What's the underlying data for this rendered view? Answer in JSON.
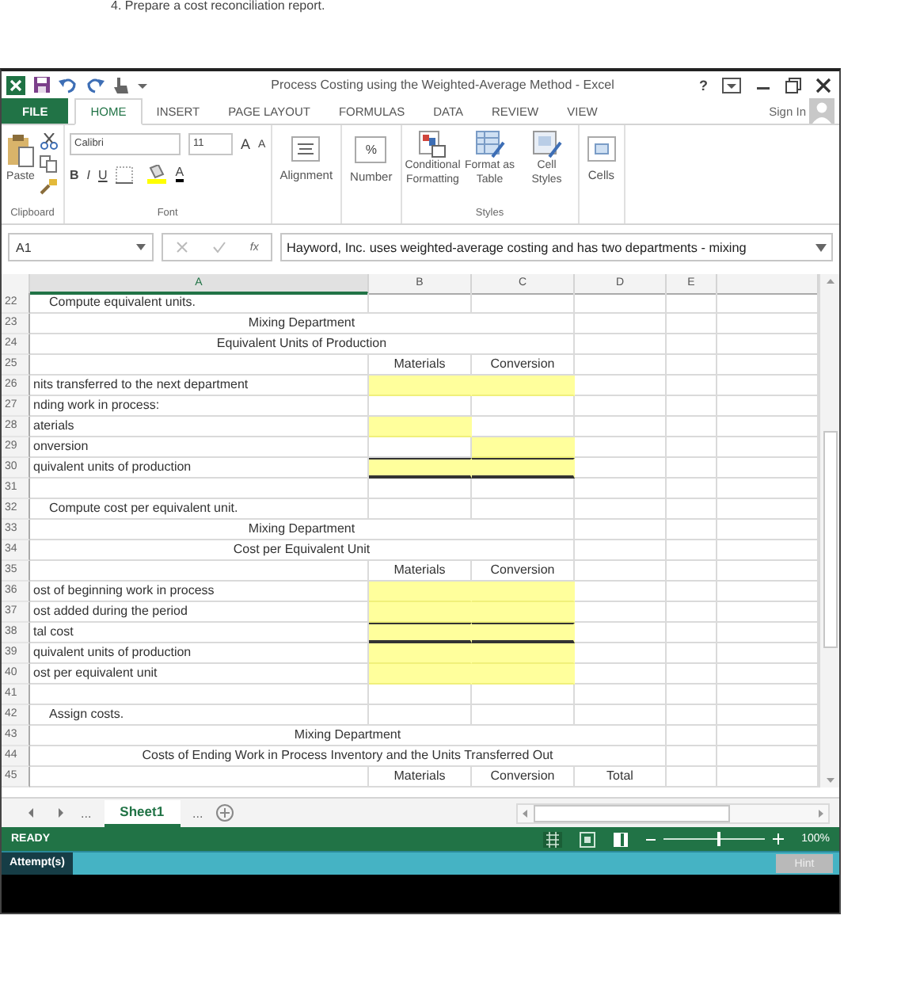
{
  "page_text": "4. Prepare a cost reconciliation report.",
  "window": {
    "title": "Process Costing using the Weighted-Average Method - Excel",
    "help": "?"
  },
  "tabs": [
    {
      "label": "FILE",
      "kind": "file",
      "selected": false
    },
    {
      "label": "HOME",
      "kind": "tab",
      "selected": true
    },
    {
      "label": "INSERT",
      "kind": "tab",
      "selected": false
    },
    {
      "label": "PAGE LAYOUT",
      "kind": "tab",
      "selected": false
    },
    {
      "label": "FORMULAS",
      "kind": "tab",
      "selected": false
    },
    {
      "label": "DATA",
      "kind": "tab",
      "selected": false
    },
    {
      "label": "REVIEW",
      "kind": "tab",
      "selected": false
    },
    {
      "label": "VIEW",
      "kind": "tab",
      "selected": false
    }
  ],
  "account": {
    "label": "Sign In"
  },
  "ribbon": {
    "clipboard": {
      "label": "Clipboard",
      "paste": "Paste"
    },
    "font": {
      "label": "Font",
      "font_name": "Calibri",
      "font_size": "11",
      "grow": "A",
      "shrink": "A",
      "bold": "B",
      "italic": "I",
      "underline": "U",
      "font_color": "A"
    },
    "alignment": {
      "label": "Alignment"
    },
    "number": {
      "label": "Number",
      "symbol": "%"
    },
    "styles": {
      "label": "Styles",
      "buttons": [
        {
          "label": "Conditional Formatting"
        },
        {
          "label": "Format as Table"
        },
        {
          "label": "Cell Styles"
        }
      ]
    },
    "cells": {
      "label": "Cells"
    }
  },
  "formula_bar": {
    "name_box": "A1",
    "function_label": "fx",
    "formula": "Hayword, Inc. uses weighted-average costing and has two departments - mixing"
  },
  "columns": [
    {
      "label": "A",
      "selected": true
    },
    {
      "label": "B",
      "selected": false
    },
    {
      "label": "C",
      "selected": false
    },
    {
      "label": "D",
      "selected": false
    },
    {
      "label": "E",
      "selected": false
    }
  ],
  "rows": [
    {
      "number": "22",
      "kind": "step",
      "label": "Compute equivalent units."
    },
    {
      "number": "23",
      "kind": "title",
      "title": "Mixing Department"
    },
    {
      "number": "24",
      "kind": "title",
      "title": "Equivalent Units of Production"
    },
    {
      "number": "25",
      "kind": "line",
      "cells": [
        {
          "text": "Materials",
          "input": false
        },
        {
          "text": "Conversion",
          "input": false
        }
      ]
    },
    {
      "number": "26",
      "kind": "line",
      "label": "nits transferred to the next department",
      "cells": [
        {
          "input": true
        },
        {
          "input": true
        }
      ]
    },
    {
      "number": "27",
      "kind": "line",
      "label": "nding work in process:",
      "cells": [
        {
          "input": false
        },
        {
          "input": false
        }
      ]
    },
    {
      "number": "28",
      "kind": "line",
      "label": "aterials",
      "cells": [
        {
          "input": true
        },
        {
          "input": false
        }
      ]
    },
    {
      "number": "29",
      "kind": "line",
      "label": "onversion",
      "cells": [
        {
          "input": false
        },
        {
          "input": true
        }
      ]
    },
    {
      "number": "30",
      "kind": "line",
      "label": "quivalent units of production",
      "rule_above": true,
      "rule_below": true,
      "cells": [
        {
          "input": true
        },
        {
          "input": true
        }
      ]
    },
    {
      "number": "31",
      "kind": "line"
    },
    {
      "number": "32",
      "kind": "step",
      "label": "Compute cost per equivalent unit."
    },
    {
      "number": "33",
      "kind": "title",
      "title": "Mixing Department"
    },
    {
      "number": "34",
      "kind": "title",
      "title": "Cost per Equivalent Unit"
    },
    {
      "number": "35",
      "kind": "line",
      "cells": [
        {
          "text": "Materials",
          "input": false
        },
        {
          "text": "Conversion",
          "input": false
        }
      ]
    },
    {
      "number": "36",
      "kind": "line",
      "label": "ost of beginning work in process",
      "cells": [
        {
          "input": true
        },
        {
          "input": true
        }
      ]
    },
    {
      "number": "37",
      "kind": "line",
      "label": "ost added during the period",
      "cells": [
        {
          "input": true
        },
        {
          "input": true
        }
      ]
    },
    {
      "number": "38",
      "kind": "line",
      "label": "tal cost",
      "rule_above": true,
      "rule_below": true,
      "cells": [
        {
          "input": true
        },
        {
          "input": true
        }
      ]
    },
    {
      "number": "39",
      "kind": "line",
      "label": "quivalent units of production",
      "cells": [
        {
          "input": true
        },
        {
          "input": true
        }
      ]
    },
    {
      "number": "40",
      "kind": "line",
      "label": "ost per equivalent unit",
      "cells": [
        {
          "input": true
        },
        {
          "input": true
        }
      ]
    },
    {
      "number": "41",
      "kind": "line"
    },
    {
      "number": "42",
      "kind": "step",
      "label": "Assign costs."
    },
    {
      "number": "43",
      "kind": "wide_title",
      "title": "Mixing Department"
    },
    {
      "number": "44",
      "kind": "wide_title",
      "title": "Costs of Ending Work in Process Inventory and the Units Transferred Out"
    },
    {
      "number": "45",
      "kind": "line",
      "cells": [
        {
          "text": "Materials",
          "input": false
        },
        {
          "text": "Conversion",
          "input": false
        },
        {
          "text": "Total",
          "input": false
        }
      ]
    }
  ],
  "sheet_bar": {
    "more_left": "...",
    "more_right": "...",
    "sheets": [
      {
        "label": "Sheet1",
        "selected": true
      }
    ]
  },
  "status_bar": {
    "status": "READY",
    "zoom": "100%",
    "level": 0.55
  },
  "assignment_bar": {
    "attempts": "Attempt(s)",
    "hint": "Hint"
  }
}
